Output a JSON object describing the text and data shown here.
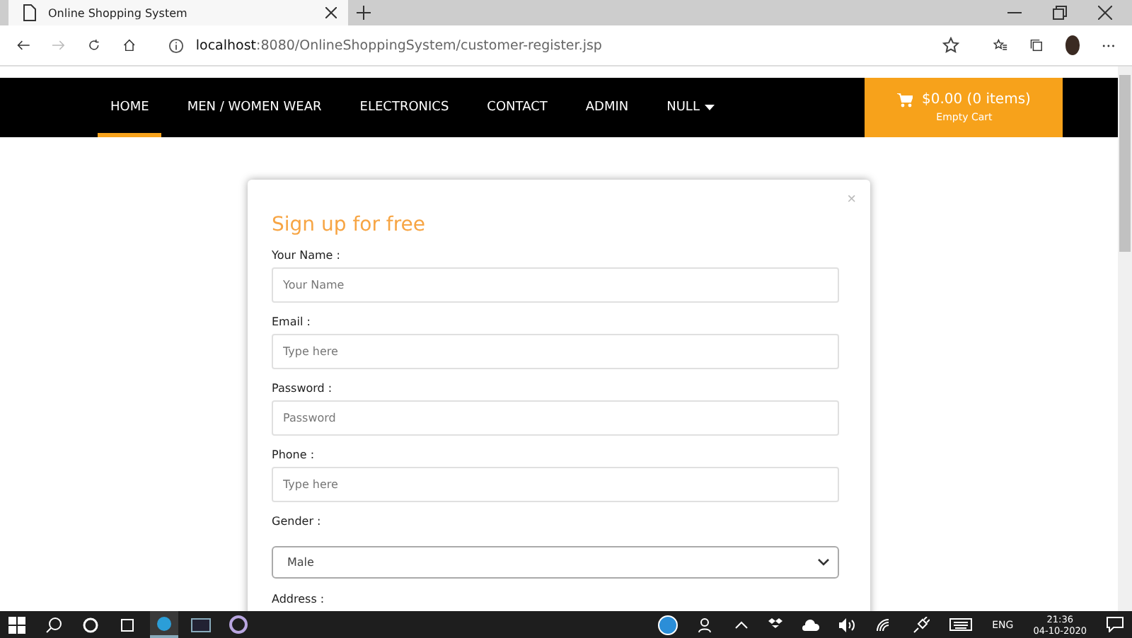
{
  "browser": {
    "tab_title": "Online Shopping System",
    "url_host": "localhost",
    "url_rest": ":8080/OnlineShoppingSystem/customer-register.jsp"
  },
  "nav": {
    "items": [
      {
        "label": "HOME",
        "selected": true,
        "dropdown": false
      },
      {
        "label": "MEN / WOMEN WEAR",
        "selected": false,
        "dropdown": false
      },
      {
        "label": "ELECTRONICS",
        "selected": false,
        "dropdown": false
      },
      {
        "label": "CONTACT",
        "selected": false,
        "dropdown": false
      },
      {
        "label": "ADMIN",
        "selected": false,
        "dropdown": false
      },
      {
        "label": "NULL",
        "selected": false,
        "dropdown": true
      }
    ],
    "cart": {
      "total": "$0.00 (0 items)",
      "note": "Empty Cart"
    }
  },
  "modal": {
    "title": "Sign up for free",
    "close": "×",
    "fields": [
      {
        "kind": "input",
        "label": "Your Name :",
        "placeholder": "Your Name"
      },
      {
        "kind": "input",
        "label": "Email :",
        "placeholder": "Type here"
      },
      {
        "kind": "input",
        "label": "Password :",
        "placeholder": "Password"
      },
      {
        "kind": "input",
        "label": "Phone :",
        "placeholder": "Type here"
      },
      {
        "kind": "select",
        "label": "Gender :",
        "value": "Male"
      },
      {
        "kind": "label",
        "label": "Address :"
      }
    ]
  },
  "taskbar": {
    "language": "ENG",
    "time": "21:36",
    "date": "04-10-2020"
  }
}
